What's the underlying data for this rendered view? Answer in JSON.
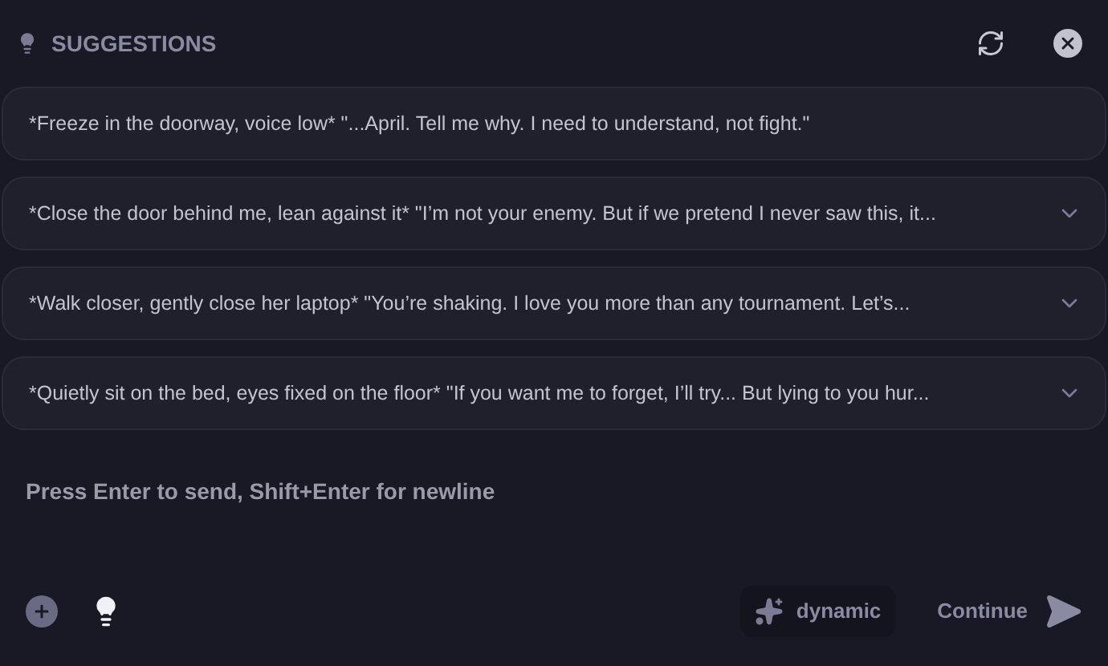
{
  "header": {
    "title": "SUGGESTIONS"
  },
  "suggestions": [
    {
      "text": "*Freeze in the doorway, voice low* \"...April. Tell me why. I need to understand, not fight.\"",
      "expandable": false
    },
    {
      "text": "*Close the door behind me, lean against it* \"I’m not your enemy. But if we pretend I never saw this, it...",
      "expandable": true
    },
    {
      "text": "*Walk closer, gently close her laptop* \"You’re shaking. I love you more than any tournament. Let’s...",
      "expandable": true
    },
    {
      "text": "*Quietly sit on the bed, eyes fixed on the floor* \"If you want me to forget, I’ll try... But lying to you hur...",
      "expandable": true
    }
  ],
  "composer": {
    "placeholder": "Press Enter to send, Shift+Enter for newline"
  },
  "mode": {
    "label": "dynamic"
  },
  "send": {
    "label": "Continue"
  }
}
